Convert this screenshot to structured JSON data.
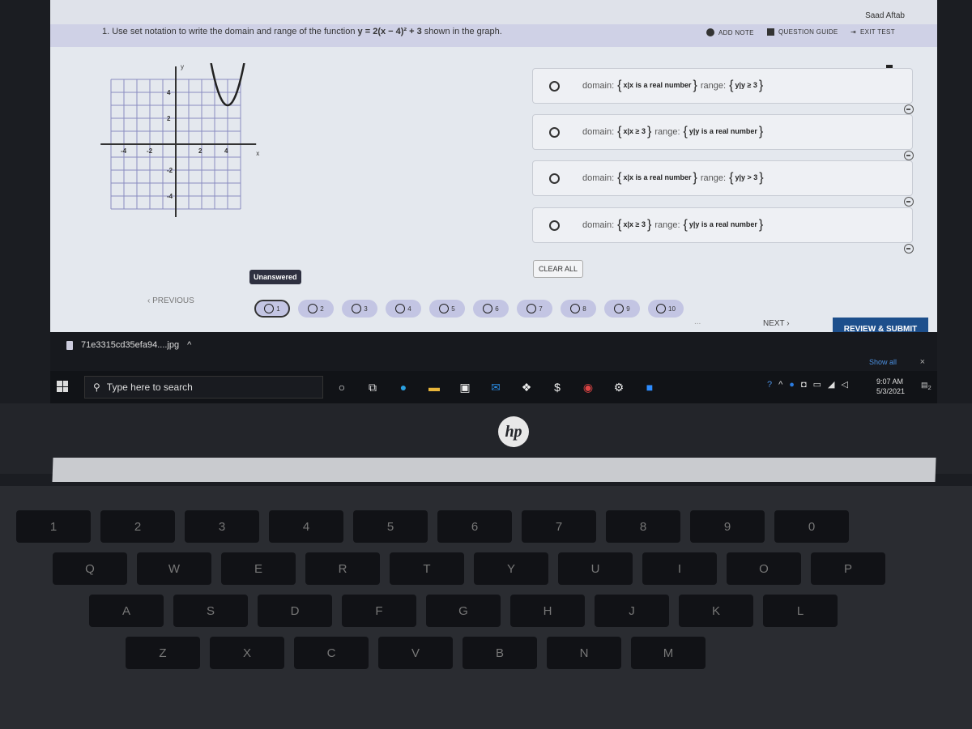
{
  "header": {
    "user_name": "Saad Aftab",
    "add_note": "ADD NOTE",
    "question_guide": "QUESTION GUIDE",
    "exit_test": "EXIT TEST"
  },
  "question": {
    "text": "1. Use set notation to write the domain and range of the function",
    "function": "y = 2(x − 4)² + 3",
    "suffix": "shown in the graph."
  },
  "graph": {
    "x_ticks": [
      "-4",
      "-2",
      "2",
      "4"
    ],
    "y_ticks": [
      "4",
      "2",
      "-2",
      "-4"
    ],
    "x_label": "x",
    "y_label": "y",
    "vertex": [
      4,
      3
    ],
    "a": 2
  },
  "options": [
    {
      "domain_label": "domain:",
      "domain": "x|x is a real number",
      "range_label": "range:",
      "range": "y|y ≥ 3"
    },
    {
      "domain_label": "domain:",
      "domain": "x|x ≥ 3",
      "range_label": "range:",
      "range": "y|y is a real number"
    },
    {
      "domain_label": "domain:",
      "domain": "x|x is a real number",
      "range_label": "range:",
      "range": "y|y > 3"
    },
    {
      "domain_label": "domain:",
      "domain": "x|x ≥ 3",
      "range_label": "range:",
      "range": "y|y is a real number"
    }
  ],
  "clear_all": "CLEAR ALL",
  "nav": {
    "tooltip": "Unanswered",
    "previous": "PREVIOUS",
    "next": "NEXT",
    "ellipsis": "...",
    "submit": "REVIEW & SUBMIT",
    "questions": [
      "1",
      "2",
      "3",
      "4",
      "5",
      "6",
      "7",
      "8",
      "9",
      "10"
    ],
    "current": "1"
  },
  "download": {
    "file": "71e3315cd35efa94....jpg",
    "show_all": "Show all",
    "close": "×"
  },
  "taskbar": {
    "search_placeholder": "Type here to search",
    "time": "9:07 AM",
    "date": "5/3/2021",
    "notifications": "2",
    "icons": [
      "cortana-icon",
      "task-view-icon",
      "edge-icon",
      "file-explorer-icon",
      "store-icon",
      "mail-icon",
      "dropbox-icon",
      "app-icon",
      "chrome-icon",
      "settings-icon",
      "zoom-icon"
    ]
  },
  "colors": {
    "accent": "#1d4f8c",
    "qnav": "#c3c5e3",
    "toolbar": "#cfd1e6"
  },
  "brand": "hp",
  "keyboard": {
    "rows": [
      [
        "1",
        "2",
        "3",
        "4",
        "5",
        "6",
        "7",
        "8",
        "9",
        "0"
      ],
      [
        "Q",
        "W",
        "E",
        "R",
        "T",
        "Y",
        "U",
        "I",
        "O",
        "P"
      ],
      [
        "A",
        "S",
        "D",
        "F",
        "G",
        "H",
        "J",
        "K",
        "L"
      ],
      [
        "Z",
        "X",
        "C",
        "V",
        "B",
        "N",
        "M"
      ]
    ]
  }
}
